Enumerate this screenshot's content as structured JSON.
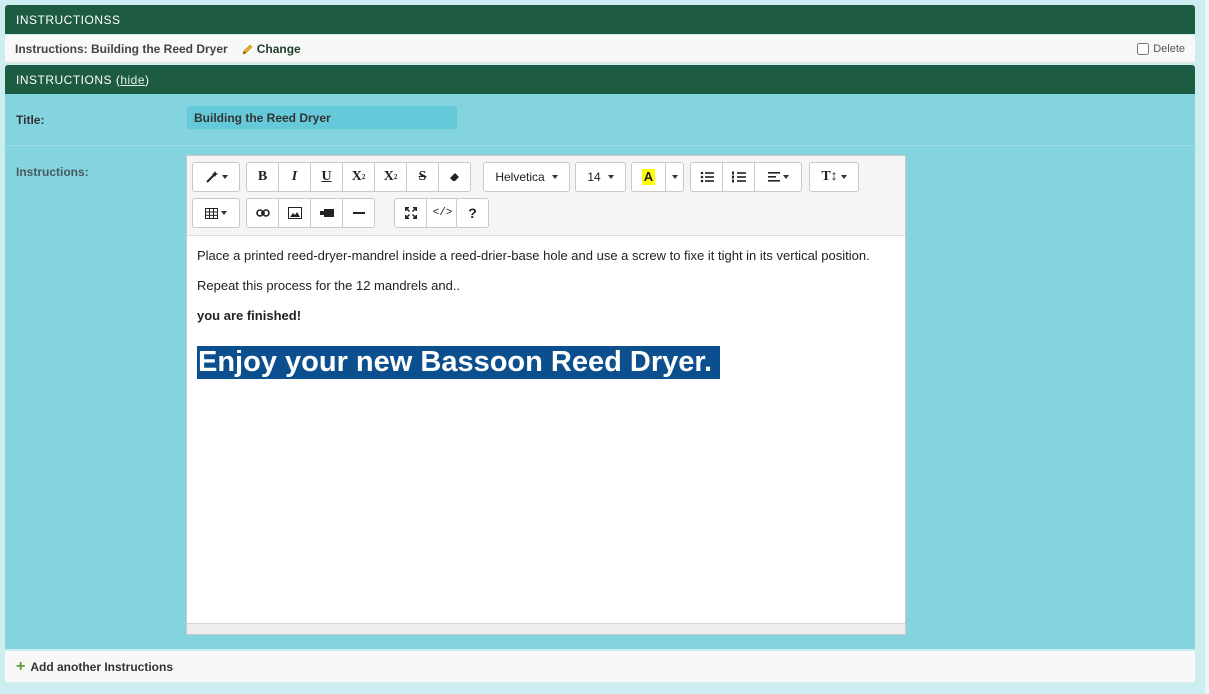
{
  "inline_group": {
    "header": "INSTRUCTIONSS",
    "object_label": "Instructions: Building the Reed Dryer",
    "change_label": "Change",
    "delete_label": "Delete"
  },
  "fieldset": {
    "header_prefix": "INSTRUCTIONS (",
    "hide_link": "hide",
    "header_suffix": ")"
  },
  "form": {
    "title_label": "Title:",
    "title_value": "Building the Reed Dryer",
    "instructions_label": "Instructions:"
  },
  "toolbar": {
    "font_name": "Helvetica",
    "font_size": "14",
    "highlight_color": "#ffff00"
  },
  "content": {
    "p1": "Place a printed reed-dryer-mandrel inside a reed-drier-base hole and use a screw to fixe it tight in its vertical position.",
    "p2": "Repeat this process for the 12 mandrels and..",
    "p3": "you are finished!",
    "heading": "Enjoy your new Bassoon Reed Dryer."
  },
  "footer": {
    "add_label": "Add another Instructions"
  },
  "colors": {
    "header_bg": "#1e5b43",
    "form_bg": "#84d4e0",
    "selection_bg": "#0b4f8e"
  }
}
